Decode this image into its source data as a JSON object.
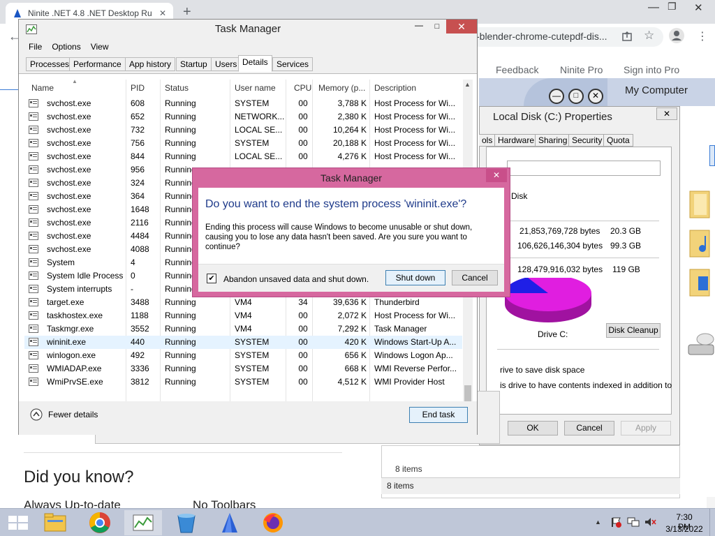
{
  "chrome": {
    "tab_title": "Ninite .NET 4.8 .NET Desktop Ru",
    "address": "-blender-chrome-cutepdf-dis...",
    "new_tab": "+"
  },
  "webpage": {
    "nav": [
      "Feedback",
      "Ninite Pro",
      "Sign into Pro"
    ],
    "did_you_know": "Did you know?",
    "always_up_to_date": "Always Up-to-date",
    "no_toolbars": "No Toolbars"
  },
  "explorer": {
    "title": "My Computer",
    "items_status": "8 items",
    "items_status2": "8 items"
  },
  "properties": {
    "title": "Local Disk (C:) Properties",
    "tabs": [
      "ols",
      "Hardware",
      "Sharing",
      "Security",
      "Quota"
    ],
    "type_label": "Disk",
    "used_bytes": "21,853,769,728 bytes",
    "used_gb": "20.3 GB",
    "free_bytes": "106,626,146,304 bytes",
    "free_gb": "99.3 GB",
    "cap_bytes": "128,479,916,032 bytes",
    "cap_gb": "119 GB",
    "drive_label": "Drive C:",
    "cleanup": "Disk Cleanup",
    "compress": "rive to save disk space",
    "index": "is drive to have contents indexed in addition to",
    "ok": "OK",
    "cancel": "Cancel",
    "apply": "Apply",
    "pie_used_fraction": 0.17
  },
  "taskmanager": {
    "title": "Task Manager",
    "menu": [
      "File",
      "Options",
      "View"
    ],
    "tabs": [
      "Processes",
      "Performance",
      "App history",
      "Startup",
      "Users",
      "Details",
      "Services"
    ],
    "active_tab": "Details",
    "columns": [
      "Name",
      "PID",
      "Status",
      "User name",
      "CPU",
      "Memory (p...",
      "Description"
    ],
    "rows": [
      {
        "name": "svchost.exe",
        "pid": "608",
        "status": "Running",
        "user": "SYSTEM",
        "cpu": "00",
        "mem": "3,788 K",
        "desc": "Host Process for Wi..."
      },
      {
        "name": "svchost.exe",
        "pid": "652",
        "status": "Running",
        "user": "NETWORK...",
        "cpu": "00",
        "mem": "2,380 K",
        "desc": "Host Process for Wi..."
      },
      {
        "name": "svchost.exe",
        "pid": "732",
        "status": "Running",
        "user": "LOCAL SE...",
        "cpu": "00",
        "mem": "10,264 K",
        "desc": "Host Process for Wi..."
      },
      {
        "name": "svchost.exe",
        "pid": "756",
        "status": "Running",
        "user": "SYSTEM",
        "cpu": "00",
        "mem": "20,188 K",
        "desc": "Host Process for Wi..."
      },
      {
        "name": "svchost.exe",
        "pid": "844",
        "status": "Running",
        "user": "LOCAL SE...",
        "cpu": "00",
        "mem": "4,276 K",
        "desc": "Host Process for Wi..."
      },
      {
        "name": "svchost.exe",
        "pid": "956",
        "status": "Running",
        "user": "",
        "cpu": "",
        "mem": "",
        "desc": ""
      },
      {
        "name": "svchost.exe",
        "pid": "324",
        "status": "Running",
        "user": "",
        "cpu": "",
        "mem": "",
        "desc": ""
      },
      {
        "name": "svchost.exe",
        "pid": "364",
        "status": "Running",
        "user": "",
        "cpu": "",
        "mem": "",
        "desc": ""
      },
      {
        "name": "svchost.exe",
        "pid": "1648",
        "status": "Running",
        "user": "",
        "cpu": "",
        "mem": "",
        "desc": ""
      },
      {
        "name": "svchost.exe",
        "pid": "2116",
        "status": "Running",
        "user": "",
        "cpu": "",
        "mem": "",
        "desc": ""
      },
      {
        "name": "svchost.exe",
        "pid": "4484",
        "status": "Running",
        "user": "",
        "cpu": "",
        "mem": "",
        "desc": ""
      },
      {
        "name": "svchost.exe",
        "pid": "4088",
        "status": "Running",
        "user": "",
        "cpu": "",
        "mem": "",
        "desc": ""
      },
      {
        "name": "System",
        "pid": "4",
        "status": "Running",
        "user": "",
        "cpu": "",
        "mem": "",
        "desc": ""
      },
      {
        "name": "System Idle Process",
        "pid": "0",
        "status": "Running",
        "user": "",
        "cpu": "",
        "mem": "",
        "desc": ""
      },
      {
        "name": "System interrupts",
        "pid": "-",
        "status": "Running",
        "user": "",
        "cpu": "",
        "mem": "",
        "desc": ""
      },
      {
        "name": "target.exe",
        "pid": "3488",
        "status": "Running",
        "user": "VM4",
        "cpu": "34",
        "mem": "39,636 K",
        "desc": "Thunderbird"
      },
      {
        "name": "taskhostex.exe",
        "pid": "1188",
        "status": "Running",
        "user": "VM4",
        "cpu": "00",
        "mem": "2,072 K",
        "desc": "Host Process for Wi..."
      },
      {
        "name": "Taskmgr.exe",
        "pid": "3552",
        "status": "Running",
        "user": "VM4",
        "cpu": "00",
        "mem": "7,292 K",
        "desc": "Task Manager"
      },
      {
        "name": "wininit.exe",
        "pid": "440",
        "status": "Running",
        "user": "SYSTEM",
        "cpu": "00",
        "mem": "420 K",
        "desc": "Windows Start-Up A..."
      },
      {
        "name": "winlogon.exe",
        "pid": "492",
        "status": "Running",
        "user": "SYSTEM",
        "cpu": "00",
        "mem": "656 K",
        "desc": "Windows Logon Ap..."
      },
      {
        "name": "WMIADAP.exe",
        "pid": "3336",
        "status": "Running",
        "user": "SYSTEM",
        "cpu": "00",
        "mem": "668 K",
        "desc": "WMI Reverse Perfor..."
      },
      {
        "name": "WmiPrvSE.exe",
        "pid": "3812",
        "status": "Running",
        "user": "SYSTEM",
        "cpu": "00",
        "mem": "4,512 K",
        "desc": "WMI Provider Host"
      }
    ],
    "selected_row": 18,
    "fewer_details": "Fewer details",
    "end_task": "End task"
  },
  "dialog": {
    "title": "Task Manager",
    "heading": "Do you want to end the system process 'wininit.exe'?",
    "body": "Ending this process will cause Windows to become unusable or shut down, causing you to lose any data hasn't been saved. Are you sure you want to continue?",
    "checkbox_label": "Abandon unsaved data and shut down.",
    "checkbox_checked": true,
    "shutdown": "Shut down",
    "cancel": "Cancel",
    "close": "✕"
  },
  "taskbar": {
    "time": "7:30 PM",
    "date": "3/13/2022"
  },
  "colors": {
    "dialog_frame": "#d6689f",
    "pie_used": "#1f1fe6",
    "pie_free": "#e01ee0",
    "taskbar": "#bfc7d8"
  }
}
